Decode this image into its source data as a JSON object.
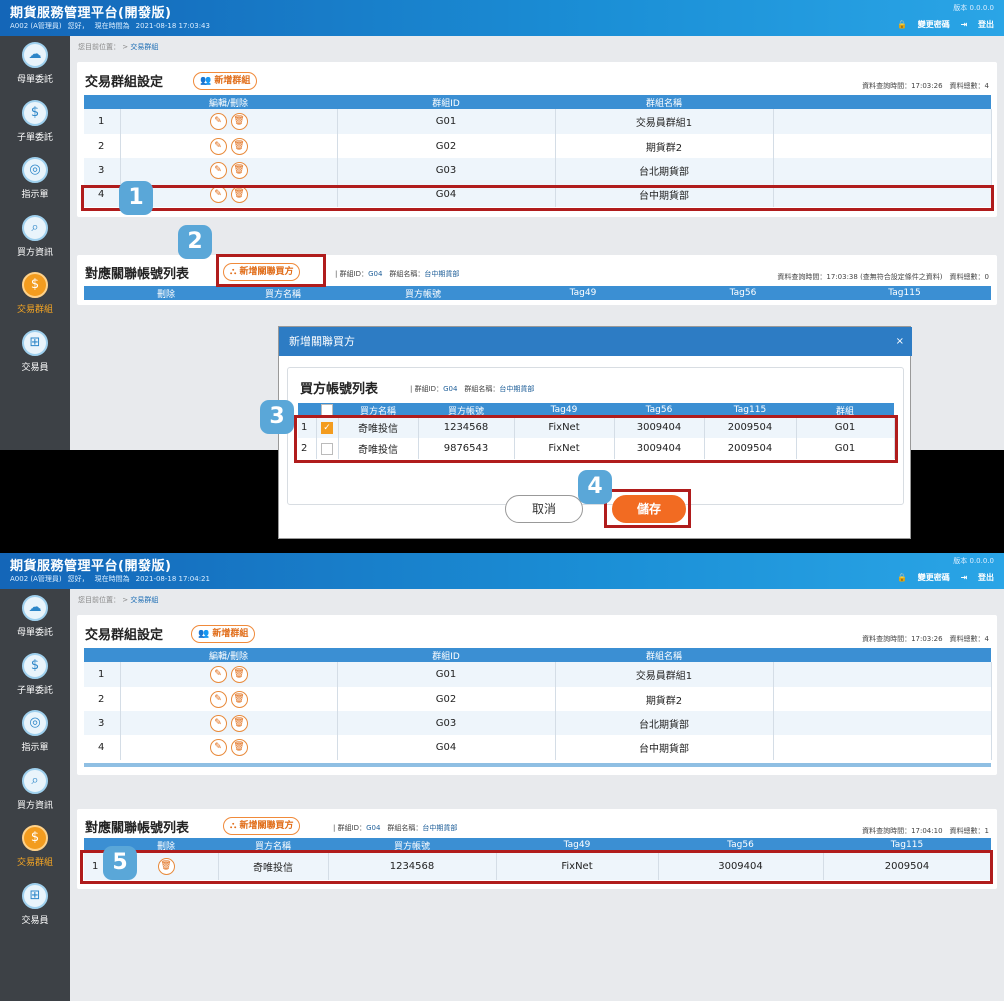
{
  "app": {
    "title": "期貨服務管理平台(開發版)",
    "user": "A002 (A管理員)",
    "greeting": "您好，",
    "time_label": "現在時間為",
    "version": "版本 0.0.0.0",
    "change_password": "變更密碼",
    "logout": "登出"
  },
  "sidebar": {
    "items": [
      {
        "label": "母單委託"
      },
      {
        "label": "子單委託"
      },
      {
        "label": "指示單"
      },
      {
        "label": "買方資訊"
      },
      {
        "label": "交易群組"
      },
      {
        "label": "交易員"
      }
    ]
  },
  "breadcrumb": {
    "prefix": "您目前位置：",
    "sep": ">",
    "current": "交易群組"
  },
  "group_section": {
    "title": "交易群組設定",
    "add_button": "新增群組",
    "headers": [
      "",
      "編輯/刪除",
      "群組ID",
      "群組名稱",
      ""
    ],
    "rows": [
      {
        "no": "1",
        "id": "G01",
        "name": "交易員群組1"
      },
      {
        "no": "2",
        "id": "G02",
        "name": "期貨群2"
      },
      {
        "no": "3",
        "id": "G03",
        "name": "台北期貨部"
      },
      {
        "no": "4",
        "id": "G04",
        "name": "台中期貨部"
      }
    ]
  },
  "link_section": {
    "title": "對應關聯帳號列表",
    "add_button": "新增關聯買方",
    "group_id_label": "群組ID：",
    "group_id": "G04",
    "group_name_label": "群組名稱：",
    "group_name": "台中期貨部",
    "headers": [
      "",
      "刪除",
      "買方名稱",
      "買方帳號",
      "Tag49",
      "Tag56",
      "Tag115"
    ]
  },
  "shot1": {
    "clock": "2021-08-18 17:03:43",
    "group_query": "資料查詢時間：17:03:26",
    "group_total": "資料總數：4",
    "link_query": "資料查詢時間：17:03:38 (查無符合設定條件之資料)",
    "link_total": "資料總數：0"
  },
  "shot2": {
    "clock": "2021-08-18 17:04:21",
    "group_query": "資料查詢時間：17:03:26",
    "group_total": "資料總數：4",
    "link_query": "資料查詢時間：17:04:10",
    "link_total": "資料總數：1",
    "link_row": {
      "no": "1",
      "buyer": "奇唯投信",
      "account": "1234568",
      "tag49": "FixNet",
      "tag56": "3009404",
      "tag115": "2009504"
    }
  },
  "modal": {
    "title": "新增關聯買方",
    "close": "×",
    "list_title": "買方帳號列表",
    "group_id_label": "群組ID：",
    "group_id": "G04",
    "group_name_label": "群組名稱：",
    "group_name": "台中期貨部",
    "headers": [
      "",
      "",
      "買方名稱",
      "買方帳號",
      "Tag49",
      "Tag56",
      "Tag115",
      "群組"
    ],
    "rows": [
      {
        "no": "1",
        "checked": true,
        "buyer": "奇唯投信",
        "account": "1234568",
        "tag49": "FixNet",
        "tag56": "3009404",
        "tag115": "2009504",
        "group": "G01"
      },
      {
        "no": "2",
        "checked": false,
        "buyer": "奇唯投信",
        "account": "9876543",
        "tag49": "FixNet",
        "tag56": "3009404",
        "tag115": "2009504",
        "group": "G01"
      }
    ],
    "cancel": "取消",
    "save": "儲存"
  },
  "badges": [
    "1",
    "2",
    "3",
    "4",
    "5"
  ],
  "icons": {
    "edit": "pencil-icon",
    "delete": "trash-icon",
    "lock": "lock-icon",
    "logout": "logout-icon"
  }
}
